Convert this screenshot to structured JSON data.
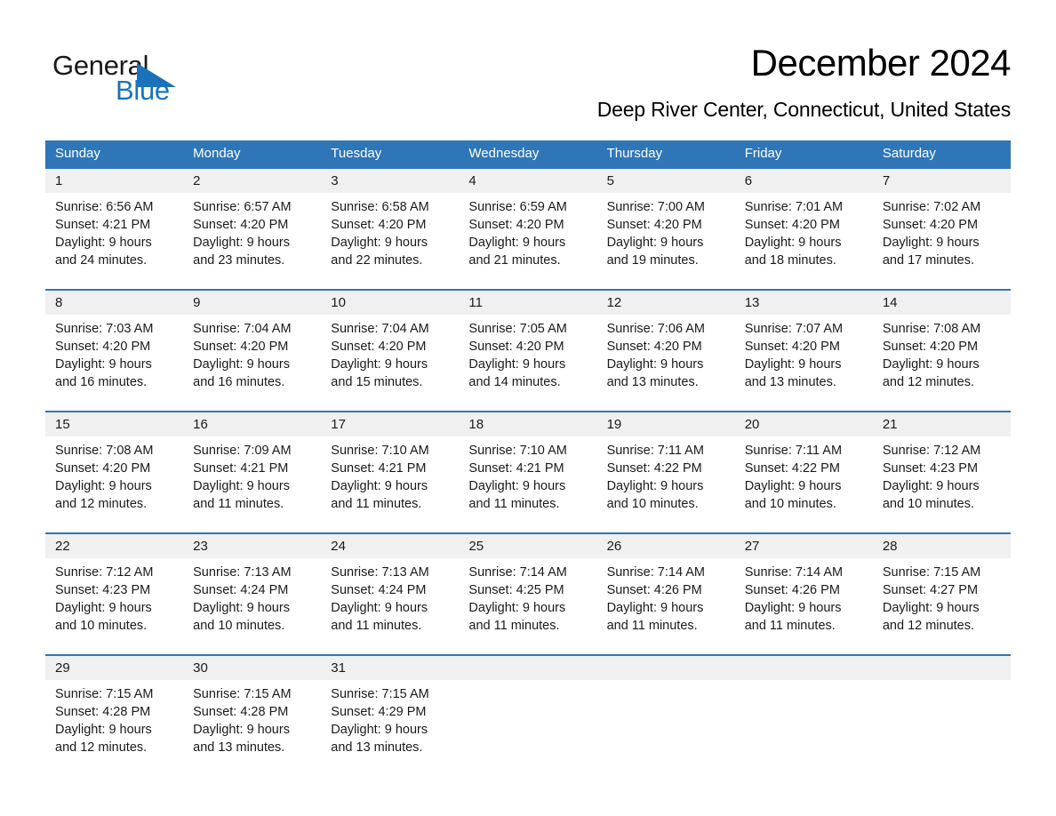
{
  "brand": {
    "name_part1": "General",
    "name_part2": "Blue",
    "triangle_color": "#1a72ba"
  },
  "header": {
    "title": "December 2024",
    "subtitle": "Deep River Center, Connecticut, United States"
  },
  "theme": {
    "header_blue": "#2e76b8",
    "date_band_gray": "#f0f0f0",
    "text_black": "#1a1a1a"
  },
  "weekdays": [
    "Sunday",
    "Monday",
    "Tuesday",
    "Wednesday",
    "Thursday",
    "Friday",
    "Saturday"
  ],
  "weeks": [
    {
      "days": [
        {
          "date": "1",
          "sunrise": "Sunrise: 6:56 AM",
          "sunset": "Sunset: 4:21 PM",
          "daylight_l1": "Daylight: 9 hours",
          "daylight_l2": "and 24 minutes."
        },
        {
          "date": "2",
          "sunrise": "Sunrise: 6:57 AM",
          "sunset": "Sunset: 4:20 PM",
          "daylight_l1": "Daylight: 9 hours",
          "daylight_l2": "and 23 minutes."
        },
        {
          "date": "3",
          "sunrise": "Sunrise: 6:58 AM",
          "sunset": "Sunset: 4:20 PM",
          "daylight_l1": "Daylight: 9 hours",
          "daylight_l2": "and 22 minutes."
        },
        {
          "date": "4",
          "sunrise": "Sunrise: 6:59 AM",
          "sunset": "Sunset: 4:20 PM",
          "daylight_l1": "Daylight: 9 hours",
          "daylight_l2": "and 21 minutes."
        },
        {
          "date": "5",
          "sunrise": "Sunrise: 7:00 AM",
          "sunset": "Sunset: 4:20 PM",
          "daylight_l1": "Daylight: 9 hours",
          "daylight_l2": "and 19 minutes."
        },
        {
          "date": "6",
          "sunrise": "Sunrise: 7:01 AM",
          "sunset": "Sunset: 4:20 PM",
          "daylight_l1": "Daylight: 9 hours",
          "daylight_l2": "and 18 minutes."
        },
        {
          "date": "7",
          "sunrise": "Sunrise: 7:02 AM",
          "sunset": "Sunset: 4:20 PM",
          "daylight_l1": "Daylight: 9 hours",
          "daylight_l2": "and 17 minutes."
        }
      ]
    },
    {
      "days": [
        {
          "date": "8",
          "sunrise": "Sunrise: 7:03 AM",
          "sunset": "Sunset: 4:20 PM",
          "daylight_l1": "Daylight: 9 hours",
          "daylight_l2": "and 16 minutes."
        },
        {
          "date": "9",
          "sunrise": "Sunrise: 7:04 AM",
          "sunset": "Sunset: 4:20 PM",
          "daylight_l1": "Daylight: 9 hours",
          "daylight_l2": "and 16 minutes."
        },
        {
          "date": "10",
          "sunrise": "Sunrise: 7:04 AM",
          "sunset": "Sunset: 4:20 PM",
          "daylight_l1": "Daylight: 9 hours",
          "daylight_l2": "and 15 minutes."
        },
        {
          "date": "11",
          "sunrise": "Sunrise: 7:05 AM",
          "sunset": "Sunset: 4:20 PM",
          "daylight_l1": "Daylight: 9 hours",
          "daylight_l2": "and 14 minutes."
        },
        {
          "date": "12",
          "sunrise": "Sunrise: 7:06 AM",
          "sunset": "Sunset: 4:20 PM",
          "daylight_l1": "Daylight: 9 hours",
          "daylight_l2": "and 13 minutes."
        },
        {
          "date": "13",
          "sunrise": "Sunrise: 7:07 AM",
          "sunset": "Sunset: 4:20 PM",
          "daylight_l1": "Daylight: 9 hours",
          "daylight_l2": "and 13 minutes."
        },
        {
          "date": "14",
          "sunrise": "Sunrise: 7:08 AM",
          "sunset": "Sunset: 4:20 PM",
          "daylight_l1": "Daylight: 9 hours",
          "daylight_l2": "and 12 minutes."
        }
      ]
    },
    {
      "days": [
        {
          "date": "15",
          "sunrise": "Sunrise: 7:08 AM",
          "sunset": "Sunset: 4:20 PM",
          "daylight_l1": "Daylight: 9 hours",
          "daylight_l2": "and 12 minutes."
        },
        {
          "date": "16",
          "sunrise": "Sunrise: 7:09 AM",
          "sunset": "Sunset: 4:21 PM",
          "daylight_l1": "Daylight: 9 hours",
          "daylight_l2": "and 11 minutes."
        },
        {
          "date": "17",
          "sunrise": "Sunrise: 7:10 AM",
          "sunset": "Sunset: 4:21 PM",
          "daylight_l1": "Daylight: 9 hours",
          "daylight_l2": "and 11 minutes."
        },
        {
          "date": "18",
          "sunrise": "Sunrise: 7:10 AM",
          "sunset": "Sunset: 4:21 PM",
          "daylight_l1": "Daylight: 9 hours",
          "daylight_l2": "and 11 minutes."
        },
        {
          "date": "19",
          "sunrise": "Sunrise: 7:11 AM",
          "sunset": "Sunset: 4:22 PM",
          "daylight_l1": "Daylight: 9 hours",
          "daylight_l2": "and 10 minutes."
        },
        {
          "date": "20",
          "sunrise": "Sunrise: 7:11 AM",
          "sunset": "Sunset: 4:22 PM",
          "daylight_l1": "Daylight: 9 hours",
          "daylight_l2": "and 10 minutes."
        },
        {
          "date": "21",
          "sunrise": "Sunrise: 7:12 AM",
          "sunset": "Sunset: 4:23 PM",
          "daylight_l1": "Daylight: 9 hours",
          "daylight_l2": "and 10 minutes."
        }
      ]
    },
    {
      "days": [
        {
          "date": "22",
          "sunrise": "Sunrise: 7:12 AM",
          "sunset": "Sunset: 4:23 PM",
          "daylight_l1": "Daylight: 9 hours",
          "daylight_l2": "and 10 minutes."
        },
        {
          "date": "23",
          "sunrise": "Sunrise: 7:13 AM",
          "sunset": "Sunset: 4:24 PM",
          "daylight_l1": "Daylight: 9 hours",
          "daylight_l2": "and 10 minutes."
        },
        {
          "date": "24",
          "sunrise": "Sunrise: 7:13 AM",
          "sunset": "Sunset: 4:24 PM",
          "daylight_l1": "Daylight: 9 hours",
          "daylight_l2": "and 11 minutes."
        },
        {
          "date": "25",
          "sunrise": "Sunrise: 7:14 AM",
          "sunset": "Sunset: 4:25 PM",
          "daylight_l1": "Daylight: 9 hours",
          "daylight_l2": "and 11 minutes."
        },
        {
          "date": "26",
          "sunrise": "Sunrise: 7:14 AM",
          "sunset": "Sunset: 4:26 PM",
          "daylight_l1": "Daylight: 9 hours",
          "daylight_l2": "and 11 minutes."
        },
        {
          "date": "27",
          "sunrise": "Sunrise: 7:14 AM",
          "sunset": "Sunset: 4:26 PM",
          "daylight_l1": "Daylight: 9 hours",
          "daylight_l2": "and 11 minutes."
        },
        {
          "date": "28",
          "sunrise": "Sunrise: 7:15 AM",
          "sunset": "Sunset: 4:27 PM",
          "daylight_l1": "Daylight: 9 hours",
          "daylight_l2": "and 12 minutes."
        }
      ]
    },
    {
      "days": [
        {
          "date": "29",
          "sunrise": "Sunrise: 7:15 AM",
          "sunset": "Sunset: 4:28 PM",
          "daylight_l1": "Daylight: 9 hours",
          "daylight_l2": "and 12 minutes."
        },
        {
          "date": "30",
          "sunrise": "Sunrise: 7:15 AM",
          "sunset": "Sunset: 4:28 PM",
          "daylight_l1": "Daylight: 9 hours",
          "daylight_l2": "and 13 minutes."
        },
        {
          "date": "31",
          "sunrise": "Sunrise: 7:15 AM",
          "sunset": "Sunset: 4:29 PM",
          "daylight_l1": "Daylight: 9 hours",
          "daylight_l2": "and 13 minutes."
        },
        {
          "date": "",
          "sunrise": "",
          "sunset": "",
          "daylight_l1": "",
          "daylight_l2": ""
        },
        {
          "date": "",
          "sunrise": "",
          "sunset": "",
          "daylight_l1": "",
          "daylight_l2": ""
        },
        {
          "date": "",
          "sunrise": "",
          "sunset": "",
          "daylight_l1": "",
          "daylight_l2": ""
        },
        {
          "date": "",
          "sunrise": "",
          "sunset": "",
          "daylight_l1": "",
          "daylight_l2": ""
        }
      ]
    }
  ]
}
